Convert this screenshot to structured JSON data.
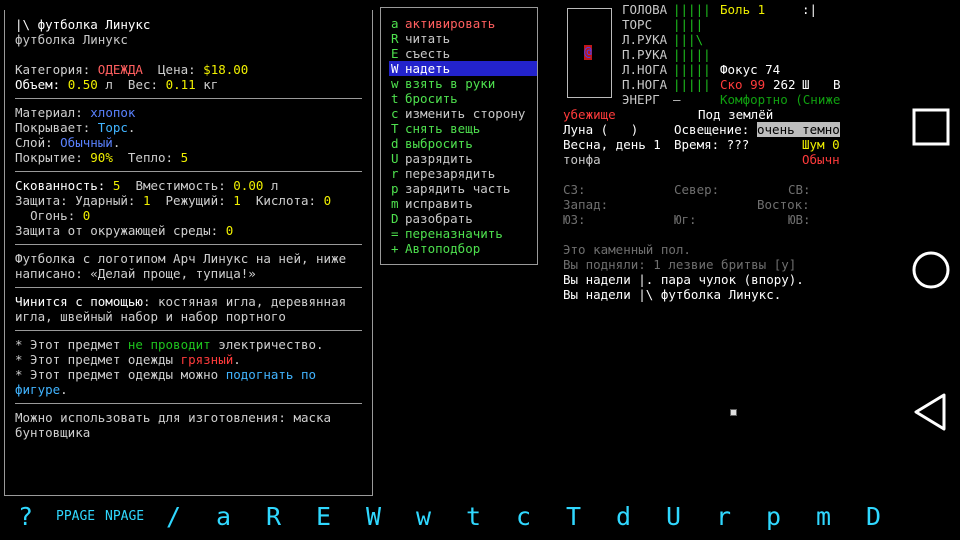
{
  "item": {
    "title": "|\\ футболка Линукс",
    "name": "футболка Линукс",
    "category_label": "Категория: ",
    "category_value": "ОДЕЖДА",
    "price_label": "Цена: ",
    "price_value": "$18.00",
    "volume_label": "Объем: ",
    "volume_value": "0.50",
    "volume_unit": "л",
    "weight_label": "Вес: ",
    "weight_value": "0.11",
    "weight_unit": "кг",
    "material_label": "Материал: ",
    "material_value": "хлопок",
    "covers_label": "Покрывает: ",
    "covers_value": "Торс",
    "layer_label": "Слой: ",
    "layer_value": "Обычный",
    "coverage_label": "Покрытие: ",
    "coverage_value": "90%",
    "warmth_label": "Тепло: ",
    "warmth_value": "5",
    "encumbrance_label": "Скованность: ",
    "encumbrance_value": "5",
    "capacity_label": "Вместимость: ",
    "capacity_value": "0.00",
    "capacity_unit": "л",
    "prot_label": "Защита: Ударный: ",
    "prot_bash": "1",
    "prot_cut_label": "Режущий: ",
    "prot_cut": "1",
    "prot_acid_label": "Кислота: ",
    "prot_acid": "0",
    "prot_fire_label": "Огонь: ",
    "prot_fire": "0",
    "env_label": "Защита от окружающей среды: ",
    "env_value": "0",
    "desc_line1": "Футболка с логотипом Арч Линукс на ней, ниже",
    "desc_line2": "написано: «Делай проще, тупица!»",
    "repair_label": "Чинится с помощью",
    "repair_line1_rest": ": костяная игла, деревянная",
    "repair_line2": "игла, швейный набор и набор портного",
    "note1_a": "* Этот предмет ",
    "note1_b": "не проводит",
    "note1_c": " электричество.",
    "note2_a": "* Этот предмет одежды ",
    "note2_b": "грязный",
    "note2_c": ".",
    "note3_a": "* Этот предмет одежды можно ",
    "note3_b": "подогнать по",
    "note3_c": "фигуре",
    "note3_d": ".",
    "craft_line1": "Можно использовать для изготовления: маска",
    "craft_line2": "бунтовщика"
  },
  "menu": [
    {
      "key": "a",
      "label": "активировать",
      "color": "#ff5f5f"
    },
    {
      "key": "R",
      "label": "читать",
      "color": "#c8c8c8"
    },
    {
      "key": "E",
      "label": "съесть",
      "color": "#c8c8c8"
    },
    {
      "key": "W",
      "label": "надеть",
      "color": "#ffffff",
      "selected": true
    },
    {
      "key": "w",
      "label": "взять в руки",
      "color": "#4ee04e"
    },
    {
      "key": "t",
      "label": "бросить",
      "color": "#4ee04e"
    },
    {
      "key": "c",
      "label": "изменить сторону",
      "color": "#c8c8c8"
    },
    {
      "key": "T",
      "label": "снять вещь",
      "color": "#4ee04e"
    },
    {
      "key": "d",
      "label": "выбросить",
      "color": "#4ee04e"
    },
    {
      "key": "U",
      "label": "разрядить",
      "color": "#c8c8c8"
    },
    {
      "key": "r",
      "label": "перезарядить",
      "color": "#c8c8c8"
    },
    {
      "key": "p",
      "label": "зарядить часть",
      "color": "#c8c8c8"
    },
    {
      "key": "m",
      "label": "исправить",
      "color": "#c8c8c8"
    },
    {
      "key": "D",
      "label": "разобрать",
      "color": "#c8c8c8"
    },
    {
      "key": "=",
      "label": "переназначить",
      "color": "#4ee04e"
    },
    {
      "key": "+",
      "label": "Автоподбор",
      "color": "#4ee04e"
    }
  ],
  "status": {
    "player_glyph": "@",
    "body_parts": [
      "ГОЛОВА",
      "ТОРС",
      "Л.РУКА",
      "П.РУКА",
      "Л.НОГА",
      "П.НОГА",
      "ЭНЕРГ"
    ],
    "hp_bars": [
      "|||||",
      "||||",
      "|||\\",
      "|||||",
      "|||||",
      "|||||",
      "—"
    ],
    "pain_label": "Боль 1",
    "pain_extra": ":|",
    "focus_label": "Фокус 74",
    "speed_label": "Ско 99",
    "moves": "262",
    "walk": "Ш",
    "dir": "В",
    "temp": "Комфортно (Сниже",
    "location": "убежище",
    "depth": "Под землёй",
    "moon": "Луна (   )",
    "light_label": "Освещение: ",
    "light_value": "очень темно",
    "season": "Весна, день 1",
    "time": "Время: ???",
    "noise": "Шум 0",
    "weapon": "тонфа",
    "stance": "Обычн"
  },
  "compass": {
    "nw": "СЗ:",
    "n": "Север:",
    "ne": "СВ:",
    "w": "Запад:",
    "e": "Восток:",
    "sw": "ЮЗ:",
    "s": "Юг:",
    "se": "ЮВ:"
  },
  "log": [
    "Это каменный пол.",
    "Вы подняли: 1 лезвие бритвы [y]",
    "Вы надели |. пара чулок (впору).",
    "Вы надели |\\ футболка Линукс."
  ],
  "bottom_keys": [
    "?",
    "PPAGE",
    "NPAGE",
    "/",
    "a",
    "R",
    "E",
    "W",
    "w",
    "t",
    "c",
    "T",
    "d",
    "U",
    "r",
    "p",
    "m",
    "D"
  ]
}
